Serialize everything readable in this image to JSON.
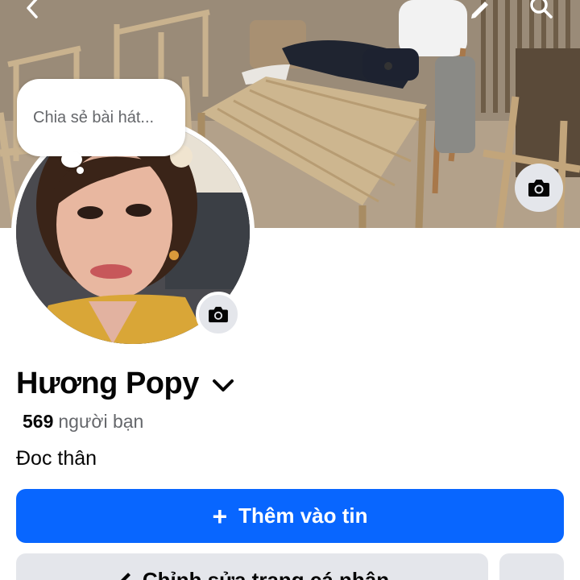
{
  "note": {
    "placeholder": "Chia sẻ bài hát..."
  },
  "profile": {
    "name": "Hương Popy",
    "friends_count": "569",
    "friends_label": "người bạn",
    "bio": "Đoc thân"
  },
  "buttons": {
    "add_story": "Thêm vào tin",
    "edit_profile": "Chỉnh sửa trang cá nhân",
    "more": "..."
  },
  "colors": {
    "primary": "#0866ff",
    "secondary_button": "#e4e6eb",
    "text_primary": "#050505",
    "text_secondary": "#65676b"
  },
  "icons": {
    "back": "chevron-left-icon",
    "edit": "pencil-icon",
    "search": "search-icon",
    "cover_camera": "camera-icon",
    "avatar_camera": "camera-icon",
    "name_dropdown": "chevron-down-icon",
    "add": "plus-icon",
    "more": "more-horizontal-icon"
  }
}
